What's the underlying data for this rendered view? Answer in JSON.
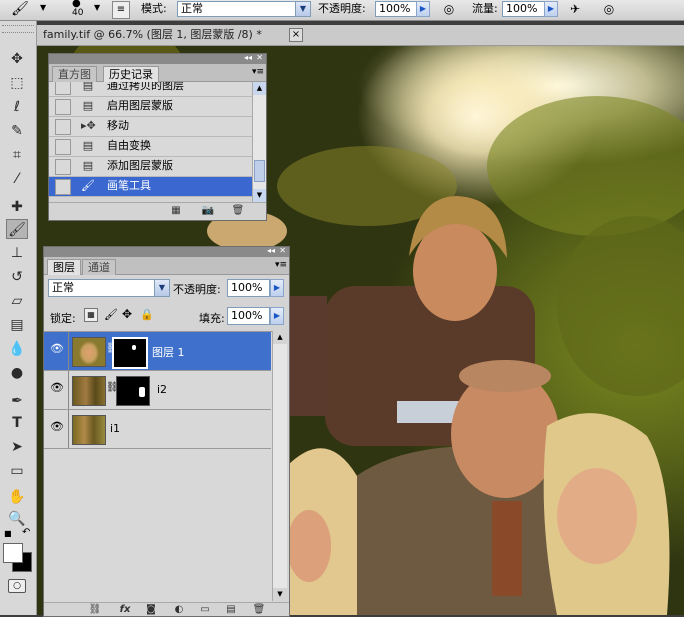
{
  "options_bar": {
    "brush_size": "40",
    "mode_label": "模式:",
    "mode_value": "正常",
    "opacity_label": "不透明度:",
    "opacity_value": "100%",
    "flow_label": "流量:",
    "flow_value": "100%"
  },
  "document": {
    "tab_title": "family.tif @ 66.7% (图层 1, 图层蒙版 /8) *",
    "close_glyph": "×"
  },
  "history_panel": {
    "tabs": [
      "直方图",
      "历史记录"
    ],
    "active_tab": 1,
    "items": [
      {
        "label": "通过拷贝的图层",
        "icon": "doc-icon",
        "selected": false
      },
      {
        "label": "启用图层蒙版",
        "icon": "doc-icon",
        "selected": false
      },
      {
        "label": "移动",
        "icon": "move-icon",
        "selected": false
      },
      {
        "label": "自由变换",
        "icon": "doc-icon",
        "selected": false
      },
      {
        "label": "添加图层蒙版",
        "icon": "doc-icon",
        "selected": false
      },
      {
        "label": "画笔工具",
        "icon": "brush-icon",
        "selected": true
      }
    ]
  },
  "layers_panel": {
    "tabs": [
      "图层",
      "通道"
    ],
    "active_tab": 0,
    "blend_mode": "正常",
    "opacity_label": "不透明度:",
    "opacity_value": "100%",
    "lock_label": "锁定:",
    "fill_label": "填充:",
    "fill_value": "100%",
    "layers": [
      {
        "name": "图层 1",
        "selected": true,
        "has_mask": true
      },
      {
        "name": "i2",
        "selected": false,
        "has_mask": true
      },
      {
        "name": "i1",
        "selected": false,
        "has_mask": false
      }
    ],
    "bottom_link_glyph": "fx"
  },
  "colors": {
    "selection_blue": "#3f71cc",
    "panel_gray": "#d4d4d4",
    "app_dark": "#3d3d3d"
  }
}
